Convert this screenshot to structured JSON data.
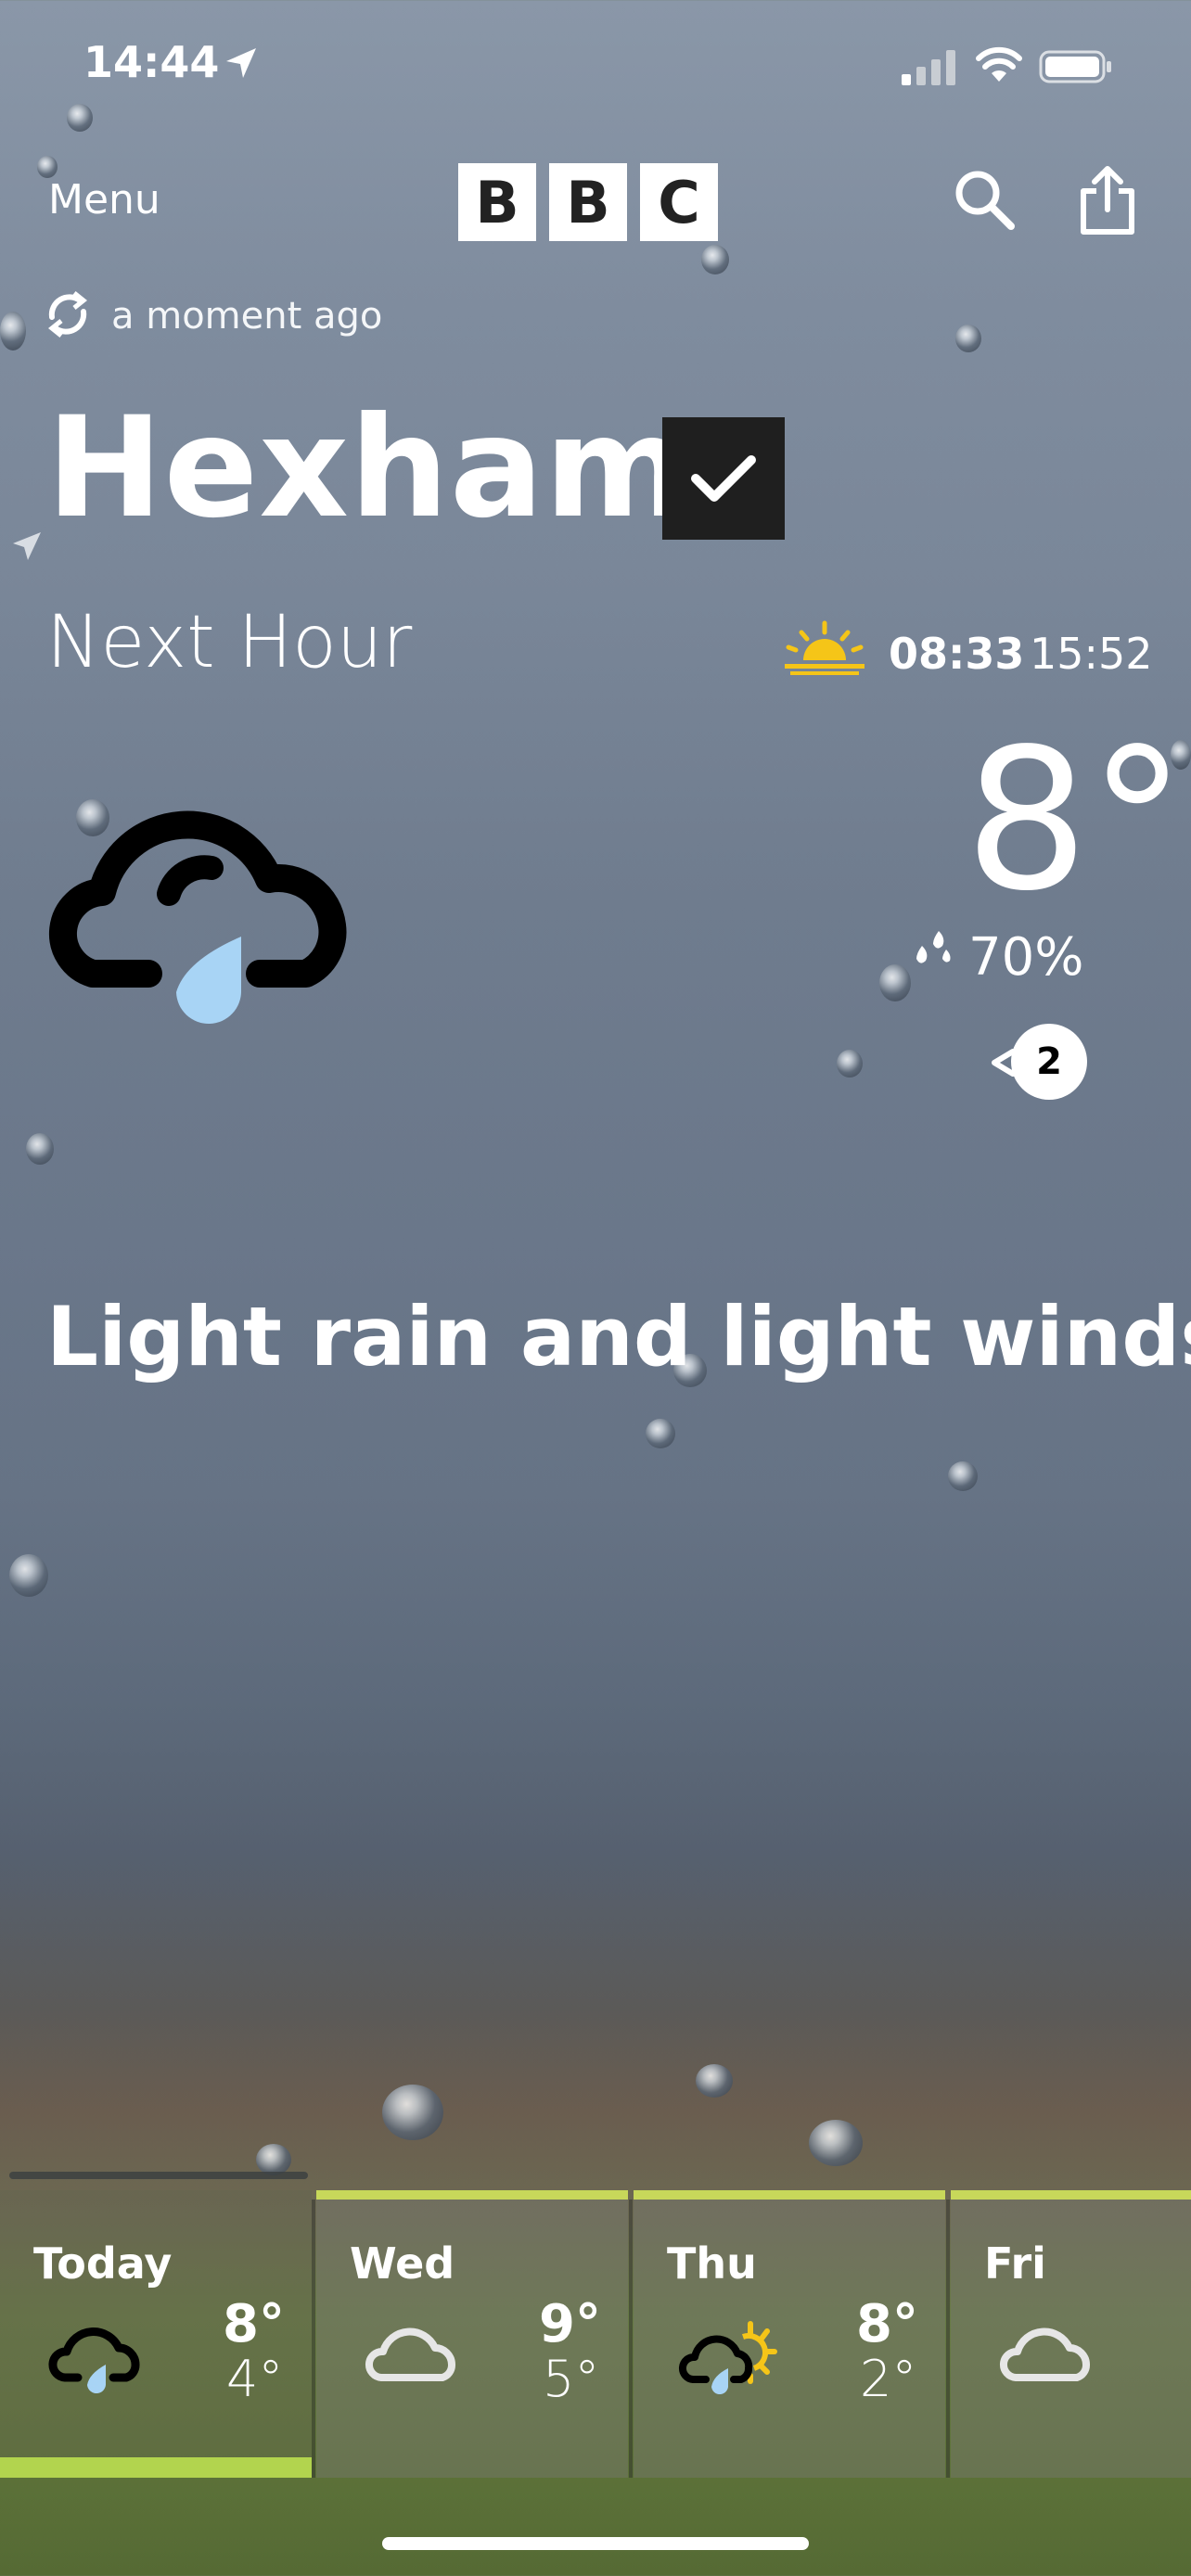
{
  "status_bar": {
    "time": "14:44"
  },
  "header": {
    "menu_label": "Menu",
    "logo_letters": [
      "B",
      "B",
      "C"
    ]
  },
  "update": {
    "text": "a moment ago"
  },
  "location": {
    "name": "Hexham"
  },
  "period": {
    "label": "Next Hour",
    "sunrise": "08:33",
    "sunset": "15:52"
  },
  "current": {
    "icon": "light-rain-cloud-icon",
    "temperature": "8°",
    "precipitation": "70%",
    "wind_speed": "2",
    "summary": "Light rain and light winds"
  },
  "forecast": [
    {
      "day": "Today",
      "icon": "light-rain-cloud-icon",
      "high": "8°",
      "low": "4°"
    },
    {
      "day": "Wed",
      "icon": "cloud-icon",
      "high": "9°",
      "low": "5°"
    },
    {
      "day": "Thu",
      "icon": "sun-cloud-rain-icon",
      "high": "8°",
      "low": "2°"
    },
    {
      "day": "Fri",
      "icon": "cloud-icon",
      "high": "",
      "low": ""
    }
  ],
  "colors": {
    "forecast_highlight": "#b2d44e",
    "sunrise": "#f5c518",
    "rain_drop": "#a8d4f5"
  }
}
